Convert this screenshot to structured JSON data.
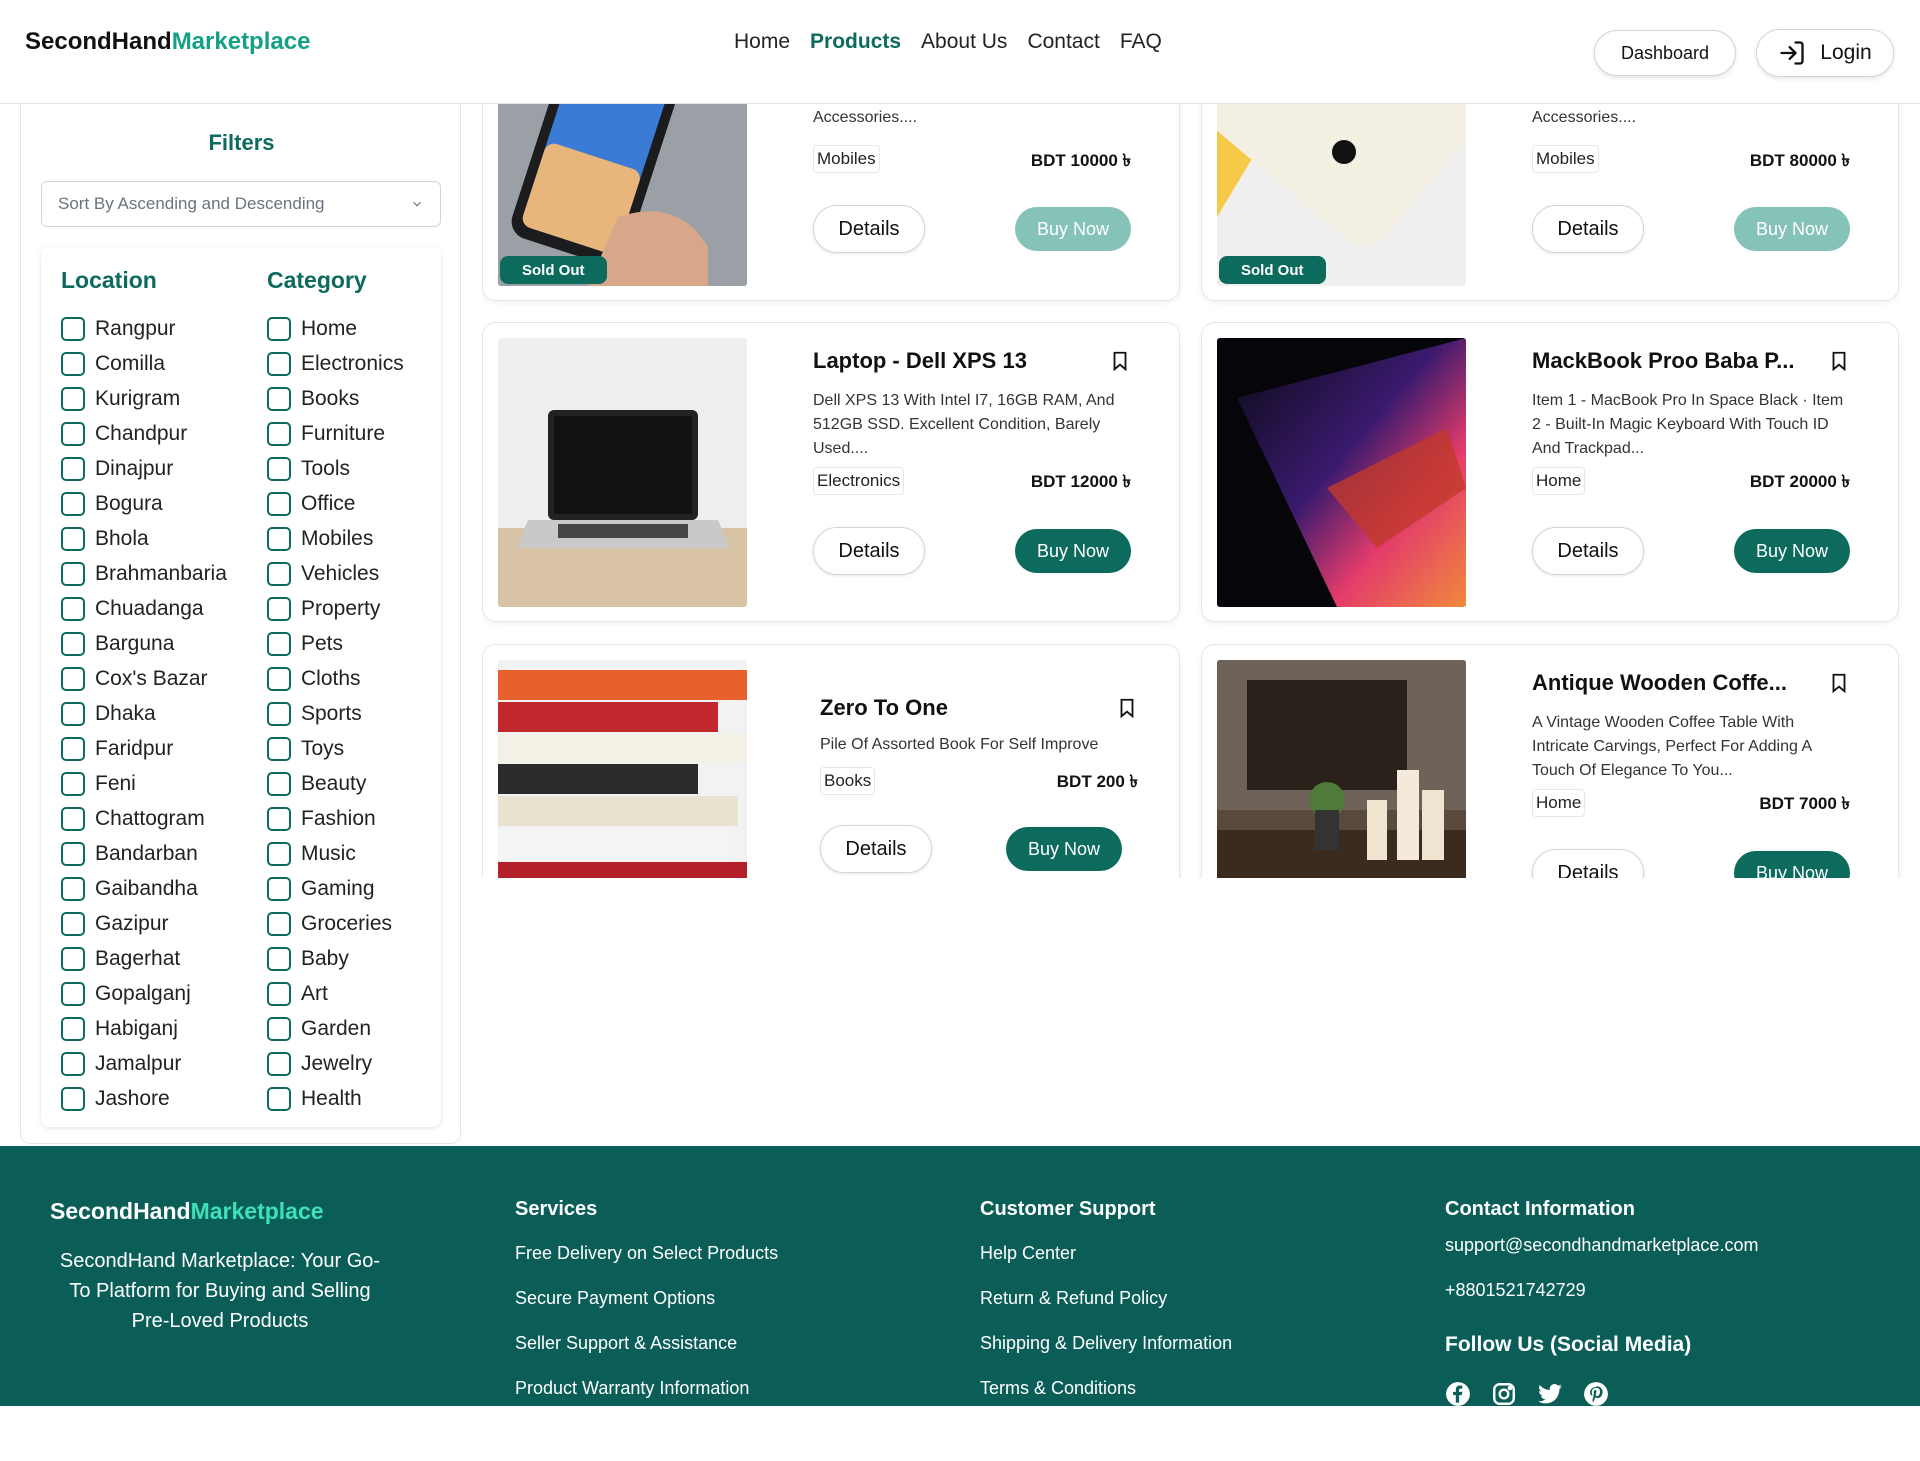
{
  "header": {
    "logo_main": "SecondHand",
    "logo_accent": "Marketplace",
    "nav": [
      "Home",
      "Products",
      "About Us",
      "Contact",
      "FAQ"
    ],
    "nav_active": "Products",
    "dashboard_label": "Dashboard",
    "login_label": "Login"
  },
  "filters": {
    "title": "Filters",
    "sort_placeholder": "Sort By Ascending and Descending",
    "location_title": "Location",
    "category_title": "Category",
    "locations": [
      "Rangpur",
      "Comilla",
      "Kurigram",
      "Chandpur",
      "Dinajpur",
      "Bogura",
      "Bhola",
      "Brahmanbaria",
      "Chuadanga",
      "Barguna",
      "Cox's Bazar",
      "Dhaka",
      "Faridpur",
      "Feni",
      "Chattogram",
      "Bandarban",
      "Gaibandha",
      "Gazipur",
      "Bagerhat",
      "Gopalganj",
      "Habiganj",
      "Jamalpur",
      "Jashore"
    ],
    "categories": [
      "Home",
      "Electronics",
      "Books",
      "Furniture",
      "Tools",
      "Office",
      "Mobiles",
      "Vehicles",
      "Property",
      "Pets",
      "Cloths",
      "Sports",
      "Toys",
      "Beauty",
      "Fashion",
      "Music",
      "Gaming",
      "Groceries",
      "Baby",
      "Art",
      "Garden",
      "Jewelry",
      "Health"
    ]
  },
  "products": [
    {
      "title": "",
      "desc": "Accessories....",
      "tag": "Mobiles",
      "price": "BDT 10000 ৳",
      "details": "Details",
      "buy": "Buy Now",
      "sold_out": "Sold Out"
    },
    {
      "title": "",
      "desc": "Accessories....",
      "tag": "Mobiles",
      "price": "BDT 80000 ৳",
      "details": "Details",
      "buy": "Buy Now",
      "sold_out": "Sold Out"
    },
    {
      "title": "Laptop - Dell XPS 13",
      "desc": "Dell XPS 13 With Intel I7, 16GB RAM, And 512GB SSD. Excellent Condition, Barely Used....",
      "tag": "Electronics",
      "price": "BDT 12000 ৳",
      "details": "Details",
      "buy": "Buy Now"
    },
    {
      "title": "MackBook Proo Baba P...",
      "desc": "Item 1 - MacBook Pro In Space Black · Item 2 - Built-In Magic Keyboard With Touch ID And Trackpad...",
      "tag": "Home",
      "price": "BDT 20000 ৳",
      "details": "Details",
      "buy": "Buy Now"
    },
    {
      "title": "Zero To One",
      "desc": "Pile Of Assorted Book For Self Improve",
      "tag": "Books",
      "price": "BDT 200 ৳",
      "details": "Details",
      "buy": "Buy Now"
    },
    {
      "title": "Antique Wooden Coffe...",
      "desc": "A Vintage Wooden Coffee Table With Intricate Carvings, Perfect For Adding A Touch Of Elegance To You...",
      "tag": "Home",
      "price": "BDT 7000 ৳",
      "details": "Details",
      "buy": "Buy Now"
    }
  ],
  "footer": {
    "logo_main": "SecondHand",
    "logo_accent": "Marketplace",
    "tagline": "SecondHand Marketplace: Your Go-To Platform for Buying and Selling Pre-Loved Products",
    "services_title": "Services",
    "services": [
      "Free Delivery on Select Products",
      "Secure Payment Options",
      "Seller Support & Assistance",
      "Product Warranty Information"
    ],
    "support_title": "Customer Support",
    "support": [
      "Help Center",
      "Return & Refund Policy",
      "Shipping & Delivery Information",
      "Terms & Conditions"
    ],
    "contact_title": "Contact Information",
    "email": "support@secondhandmarketplace.com",
    "phone": "+8801521742729",
    "follow_title": "Follow Us (Social Media)",
    "social_icons": [
      "facebook-icon",
      "instagram-icon",
      "twitter-icon",
      "pinterest-icon"
    ]
  },
  "colors": {
    "brand": "#0d6b5e",
    "accent": "#14a085",
    "footer_bg": "#0b5e58",
    "buy_disabled": "#85c2b8"
  }
}
